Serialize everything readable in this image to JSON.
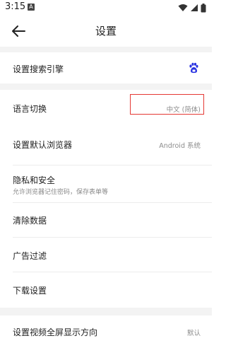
{
  "status_bar": {
    "time": "3:15",
    "notif_glyph": "A"
  },
  "header": {
    "title": "设置"
  },
  "sections": {
    "search_engine": {
      "label": "设置搜索引擎",
      "icon": "baidu-paw-icon"
    },
    "language": {
      "label": "语言切换",
      "value": "中文 (简体)"
    },
    "default_browser": {
      "label": "设置默认浏览器",
      "value": "Android 系统"
    },
    "privacy": {
      "label": "隐私和安全",
      "subtitle": "允许浏览器记住密码，保存表单等"
    },
    "clear_data": {
      "label": "清除数据"
    },
    "ad_filter": {
      "label": "广告过滤"
    },
    "download": {
      "label": "下载设置"
    },
    "video_orientation": {
      "label": "设置视频全屏显示方向",
      "value": "默认"
    }
  },
  "colors": {
    "highlight": "#e53935",
    "baidu_blue": "#2932e1",
    "section_gap": "#f3f3f3"
  }
}
